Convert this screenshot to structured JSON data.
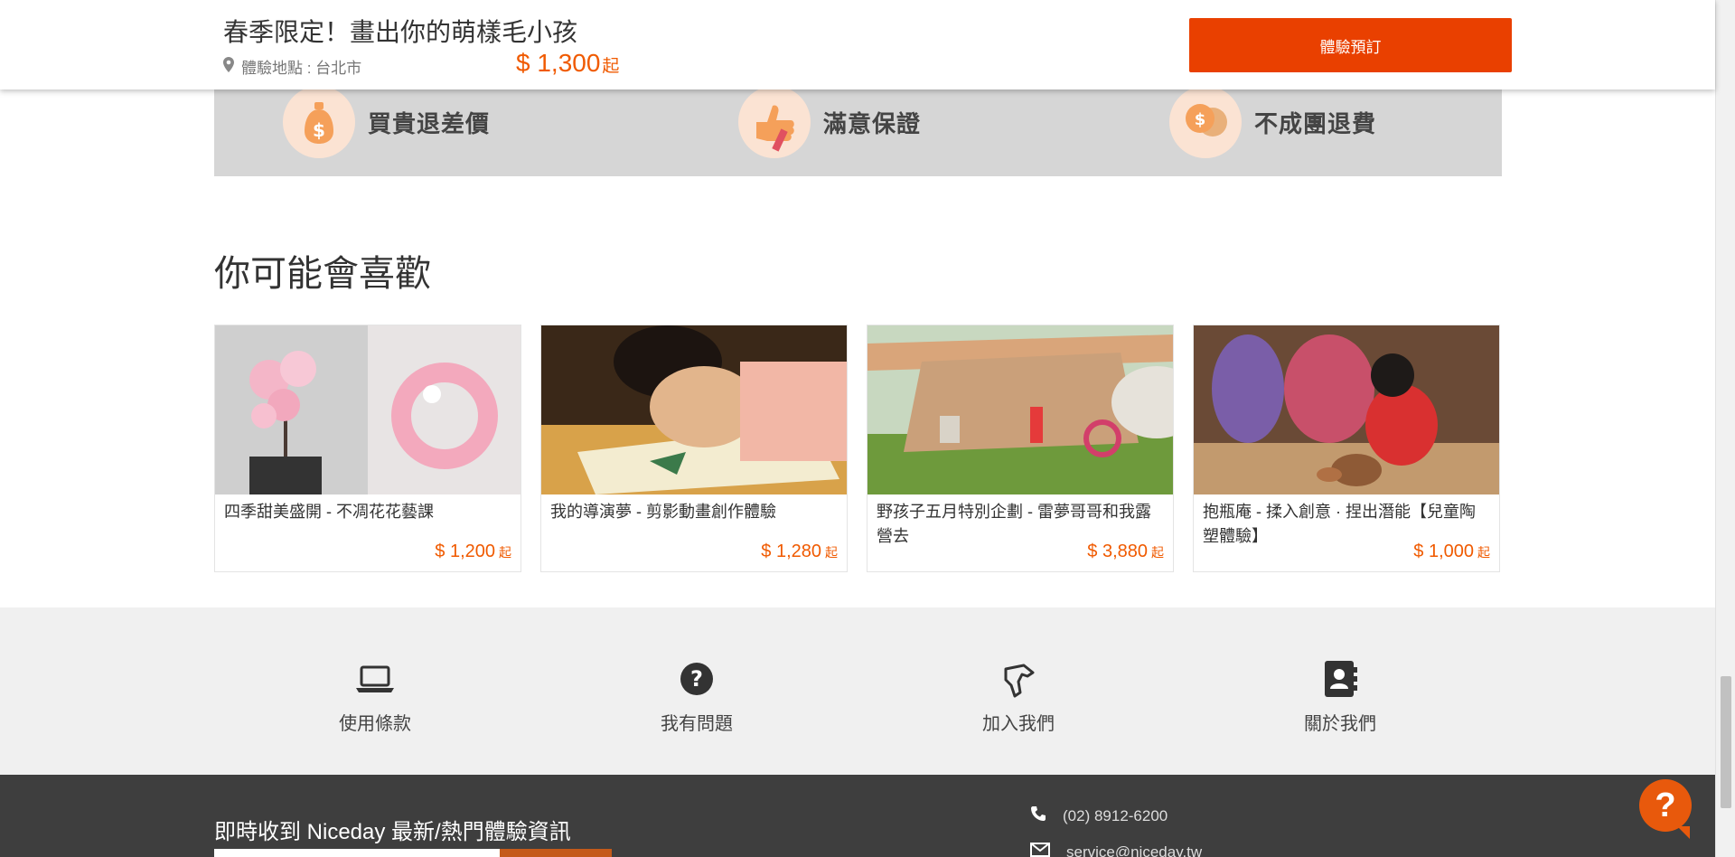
{
  "header": {
    "title": "春季限定！畫出你的萌樣毛小孩",
    "location": "體驗地點 : 台北市",
    "price": "$ 1,300",
    "price_unit": "起",
    "book_label": "體驗預訂"
  },
  "guarantees": [
    {
      "label": "買貴退差價",
      "icon": "money-bag-icon"
    },
    {
      "label": "滿意保證",
      "icon": "thumbs-up-icon"
    },
    {
      "label": "不成團退費",
      "icon": "coins-icon"
    }
  ],
  "recommendations": {
    "heading": "你可能會喜歡",
    "items": [
      {
        "title": "四季甜美盛開 - 不凋花花藝課",
        "price": "$ 1,200",
        "unit": "起"
      },
      {
        "title": "我的導演夢 - 剪影動畫創作體驗",
        "price": "$ 1,280",
        "unit": "起"
      },
      {
        "title": "野孩子五月特別企劃 - 雷夢哥哥和我露營去",
        "price": "$ 3,880",
        "unit": "起"
      },
      {
        "title": "抱瓶庵 - 揉入創意 · 捏出潛能【兒童陶塑體驗】",
        "price": "$ 1,000",
        "unit": "起"
      }
    ]
  },
  "footer_links": [
    {
      "label": "使用條款",
      "icon": "laptop-icon"
    },
    {
      "label": "我有問題",
      "icon": "question-circle-icon"
    },
    {
      "label": "加入我們",
      "icon": "handshake-icon"
    },
    {
      "label": "關於我們",
      "icon": "contact-book-icon"
    }
  ],
  "newsletter": {
    "title": "即時收到 Niceday 最新/熱門體驗資訊"
  },
  "contact": {
    "phone": "(02) 8912-6200",
    "email": "service@niceday.tw"
  },
  "help": {
    "label": "?"
  },
  "colors": {
    "accent": "#e94000",
    "price": "#f05a00",
    "guarantee_bg": "#d6d6d6",
    "footer_light": "#f0f0f0",
    "footer_dark": "#3e3e3e"
  }
}
